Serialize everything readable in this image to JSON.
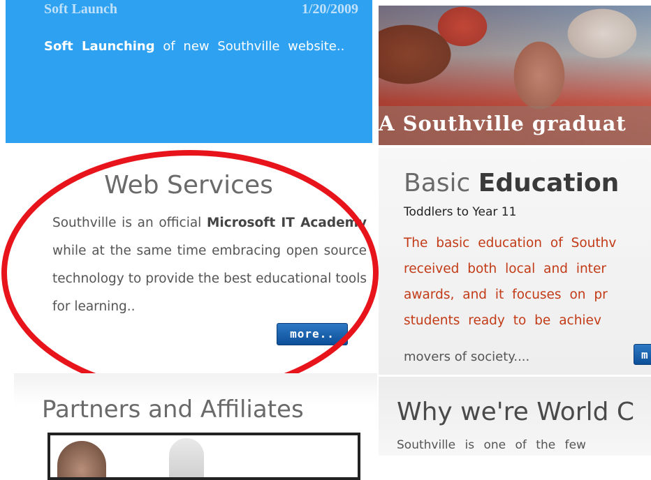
{
  "news": {
    "title": "Soft Launch",
    "date": "1/20/2009",
    "body_bold": "Soft Launching",
    "body_rest": " of new Southville website.."
  },
  "photo": {
    "caption": "A Southville graduat"
  },
  "web_services": {
    "title": "Web Services",
    "text_1": "Southville is an official ",
    "bold_1": "Microsoft IT Academy",
    "text_2": " while at the same time embracing open source technology to provide the best educational tools for learning..",
    "more_label": "more.."
  },
  "basic_education": {
    "title_light": "Basic ",
    "title_bold": "Education",
    "subtitle": "Toddlers to Year 11",
    "lines": [
      "The basic education of Southv",
      "received both local and inter",
      "awards, and it focuses on pr",
      "students ready to be achiev"
    ],
    "movers": "movers of society....",
    "more_label": "m"
  },
  "partners": {
    "title": "Partners and Affiliates"
  },
  "world_class": {
    "title": "Why we're World C",
    "body": "Southville is one of the few"
  },
  "colors": {
    "news_bg": "#2ea1f0",
    "button_bg": "#0d4f99",
    "highlight": "#e8141c",
    "education_text": "#c23a16"
  }
}
